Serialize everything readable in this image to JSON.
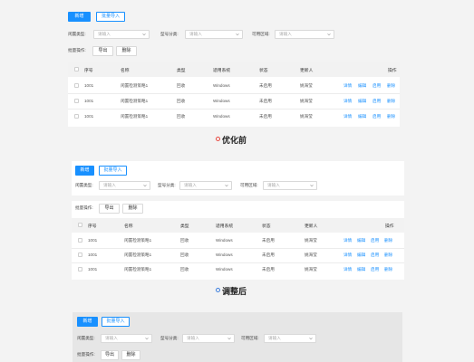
{
  "labels": {
    "add": "新增",
    "batch_import": "批量导入",
    "idle_type": "闲置类型:",
    "model_category": "型号分类:",
    "available_area": "可用区域:",
    "placeholder": "请输入",
    "batch_ops": "批量操作:",
    "export": "导出",
    "delete": "删除",
    "detail": "详情",
    "edit": "编辑",
    "enable": "启用"
  },
  "table": {
    "columns": [
      "序号",
      "名称",
      "类型",
      "适用系统",
      "状态",
      "更新人",
      "操作"
    ],
    "rows": [
      {
        "id": "1001",
        "name": "闲置检测策略1",
        "type": "回收",
        "system": "Windows",
        "status": "未启用",
        "updater": "姚海莹"
      },
      {
        "id": "1001",
        "name": "闲置检测策略1",
        "type": "回收",
        "system": "Windows",
        "status": "未启用",
        "updater": "姚海莹"
      },
      {
        "id": "1001",
        "name": "闲置检测策略1",
        "type": "回收",
        "system": "Windows",
        "status": "未启用",
        "updater": "姚海莹"
      }
    ]
  },
  "captions": {
    "before": "优化前",
    "after": "调整后"
  },
  "colors": {
    "accent": "#1890ff",
    "before_dot": "#e8483f",
    "after_dot": "#3b7ddd"
  }
}
